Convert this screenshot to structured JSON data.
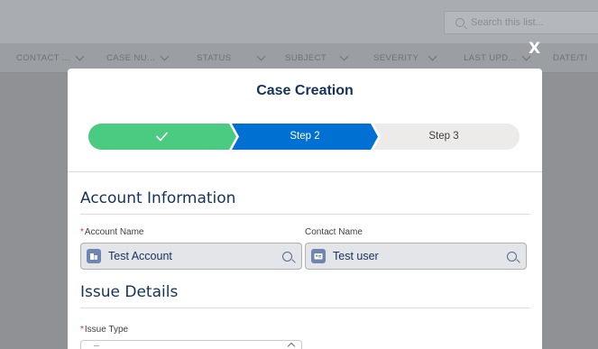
{
  "background": {
    "search_placeholder": "Search this list...",
    "columns": [
      {
        "label": "CONTACT ...",
        "has_chevron": true
      },
      {
        "label": "CASE NU...",
        "has_chevron": true
      },
      {
        "label": "STATUS",
        "has_chevron": true
      },
      {
        "label": "SUBJECT",
        "has_chevron": true
      },
      {
        "label": "SEVERITY",
        "has_chevron": true
      },
      {
        "label": "LAST UPD...",
        "has_chevron": true
      },
      {
        "label": "DATE/TI",
        "has_chevron": false
      }
    ]
  },
  "modal": {
    "close_label": "X",
    "title": "Case Creation",
    "steps": [
      {
        "label": "",
        "state": "complete",
        "icon": "check-icon"
      },
      {
        "label": "Step 2",
        "state": "current"
      },
      {
        "label": "Step 3",
        "state": "incomplete"
      }
    ],
    "colors": {
      "complete": "#4bca81",
      "current": "#0070d2",
      "incomplete": "#ecebea",
      "heading": "#16325c",
      "required": "#c23934"
    },
    "sections": {
      "account": {
        "title": "Account Information",
        "account_name_label": "Account Name",
        "account_name_value": "Test Account",
        "account_name_icon": "account-icon",
        "contact_name_label": "Contact Name",
        "contact_name_value": "Test user",
        "contact_name_icon": "contact-icon",
        "required_mark": "*"
      },
      "issue": {
        "title": "Issue Details",
        "issue_type_label": "Issue Type",
        "required_mark": "*"
      }
    }
  }
}
